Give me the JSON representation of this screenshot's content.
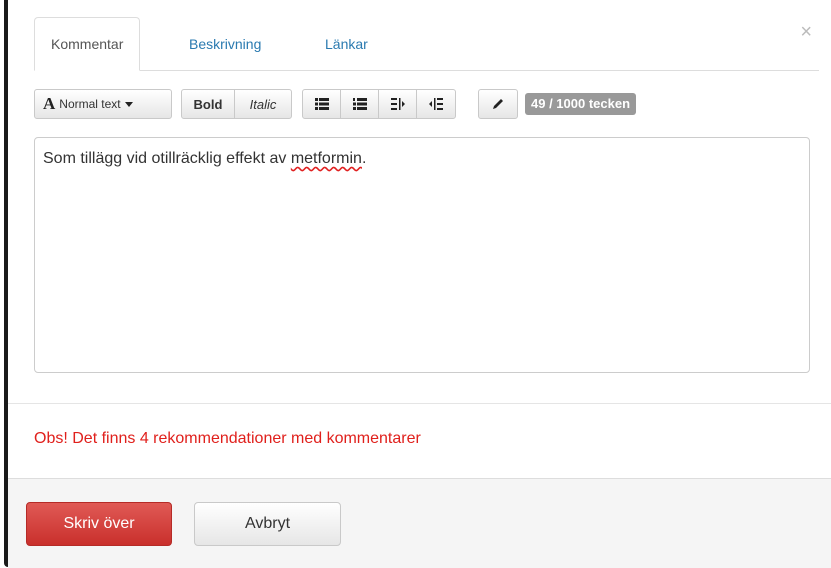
{
  "dialog": {
    "close_glyph": "×",
    "tabs": [
      {
        "label": "Kommentar",
        "active": true
      },
      {
        "label": "Beskrivning",
        "active": false
      },
      {
        "label": "Länkar",
        "active": false
      }
    ],
    "toolbar": {
      "format_icon": "A",
      "format_label": "Normal text",
      "bold_label": "Bold",
      "italic_label": "Italic",
      "icons": [
        "unordered-list-icon",
        "ordered-list-icon",
        "outdent-icon",
        "indent-icon",
        "pencil-icon"
      ],
      "counter": "49 / 1000 tecken"
    },
    "editor": {
      "text_before": "Som tillägg vid otillräcklig effekt av ",
      "misspelled_word": "metformin",
      "text_after": "."
    },
    "warning": "Obs! Det finns 4 rekommendationer med kommentarer",
    "buttons": {
      "primary": "Skriv över",
      "secondary": "Avbryt"
    }
  },
  "colors": {
    "link": "#2a7ab0",
    "warning": "#e0201c",
    "primary_button": "#c9302c",
    "counter_badge": "#999999"
  }
}
